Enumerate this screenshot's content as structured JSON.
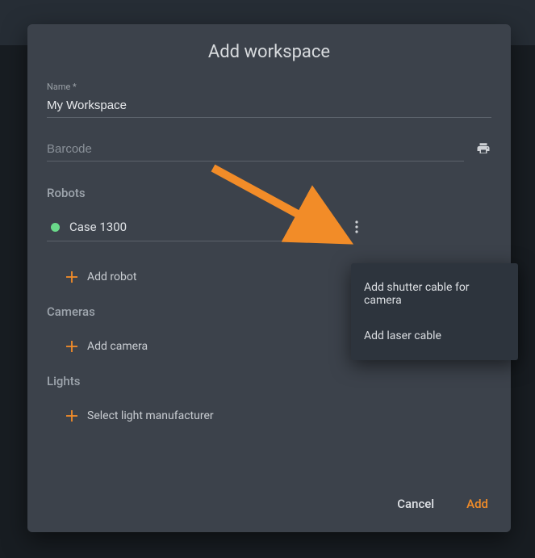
{
  "dialog": {
    "title": "Add workspace",
    "nameField": {
      "label": "Name *",
      "value": "My Workspace"
    },
    "barcodeField": {
      "placeholder": "Barcode",
      "value": ""
    },
    "sections": {
      "robots": {
        "heading": "Robots"
      },
      "cameras": {
        "heading": "Cameras"
      },
      "lights": {
        "heading": "Lights"
      }
    },
    "robotSelect": {
      "value": "Case 1300",
      "statusColor": "#6ad98a"
    },
    "addRobotLabel": "Add robot",
    "addCameraLabel": "Add camera",
    "selectLightLabel": "Select light manufacturer",
    "actions": {
      "cancel": "Cancel",
      "add": "Add"
    }
  },
  "popupMenu": {
    "items": [
      "Add shutter cable for camera",
      "Add laser cable"
    ]
  },
  "colors": {
    "accent": "#f28c28"
  }
}
